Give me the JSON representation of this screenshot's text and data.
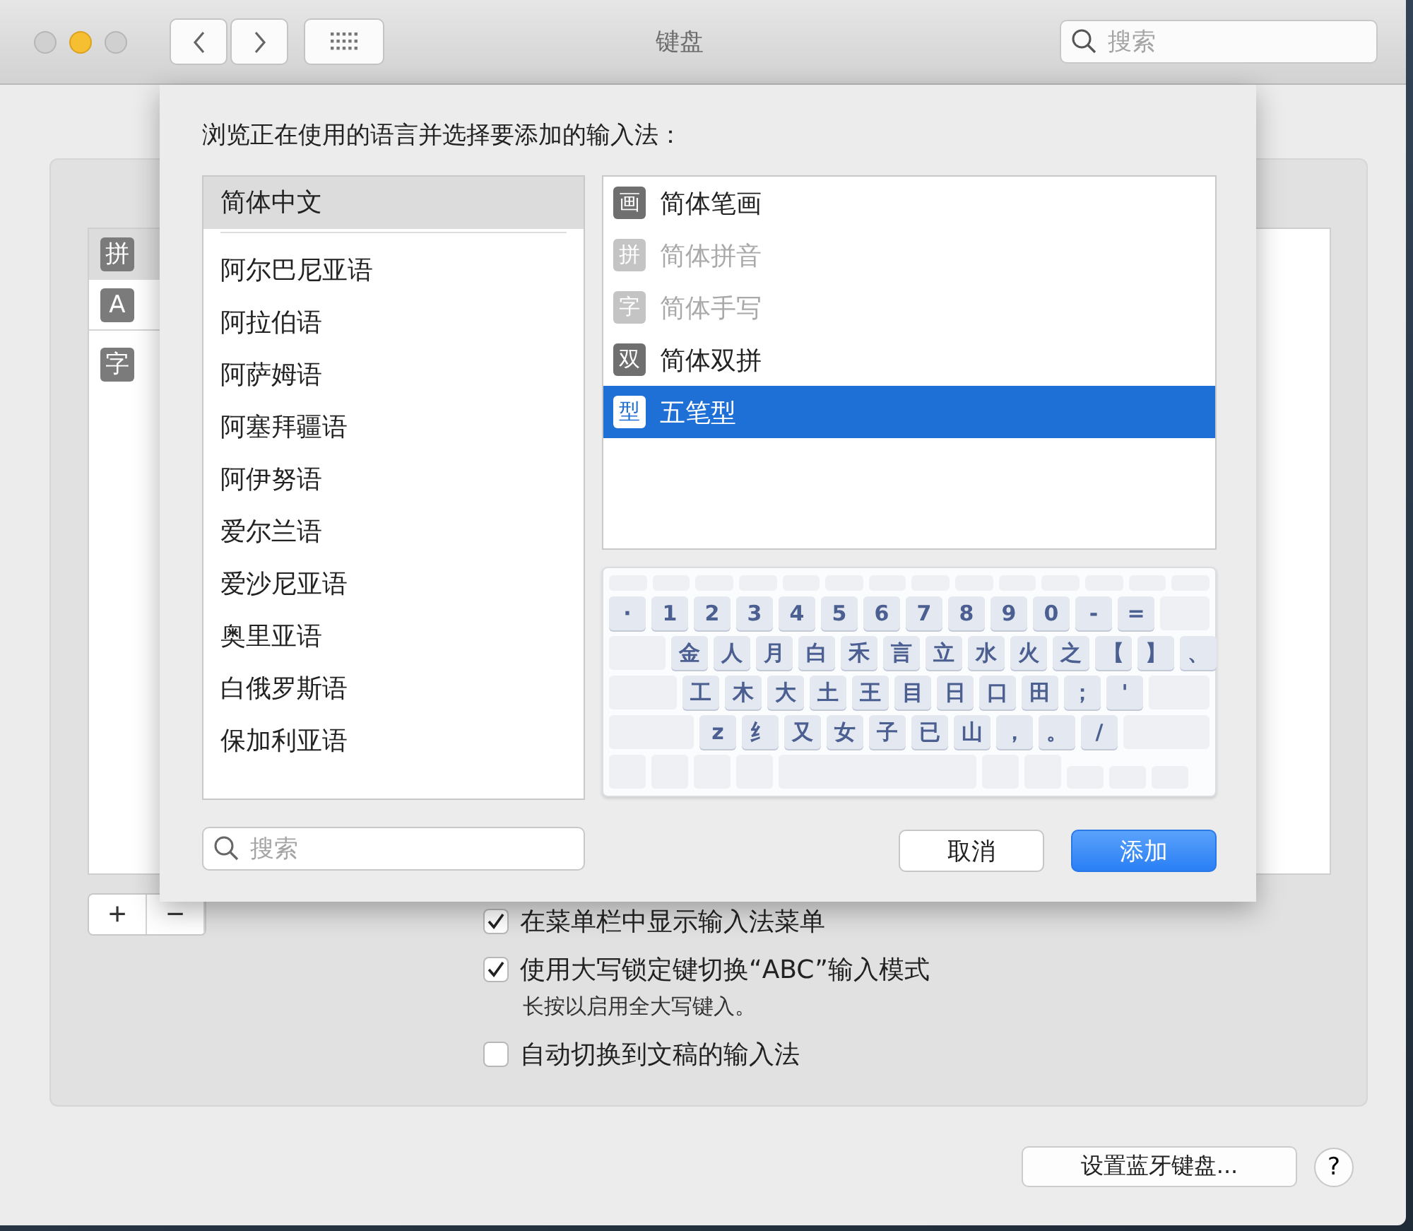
{
  "window": {
    "title": "键盘",
    "search": {
      "placeholder": "搜索"
    }
  },
  "background_list": {
    "items": [
      {
        "icon": "拼",
        "selected": true
      },
      {
        "icon": "A",
        "selected": false
      },
      {
        "icon": "字",
        "selected": false
      }
    ]
  },
  "sheet": {
    "prompt": "浏览正在使用的语言并选择要添加的输入法：",
    "languages": [
      {
        "label": "简体中文",
        "selected": true
      },
      {
        "label": "阿尔巴尼亚语",
        "selected": false
      },
      {
        "label": "阿拉伯语",
        "selected": false
      },
      {
        "label": "阿萨姆语",
        "selected": false
      },
      {
        "label": "阿塞拜疆语",
        "selected": false
      },
      {
        "label": "阿伊努语",
        "selected": false
      },
      {
        "label": "爱尔兰语",
        "selected": false
      },
      {
        "label": "爱沙尼亚语",
        "selected": false
      },
      {
        "label": "奥里亚语",
        "selected": false
      },
      {
        "label": "白俄罗斯语",
        "selected": false
      },
      {
        "label": "保加利亚语",
        "selected": false
      }
    ],
    "input_methods": [
      {
        "icon": "画",
        "label": "简体笔画",
        "disabled": false,
        "selected": false
      },
      {
        "icon": "拼",
        "label": "简体拼音",
        "disabled": true,
        "selected": false
      },
      {
        "icon": "字",
        "label": "简体手写",
        "disabled": true,
        "selected": false
      },
      {
        "icon": "双",
        "label": "简体双拼",
        "disabled": false,
        "selected": false
      },
      {
        "icon": "型",
        "label": "五笔型",
        "disabled": false,
        "selected": true
      }
    ],
    "keyboard": {
      "rows": [
        [
          "·",
          "1",
          "2",
          "3",
          "4",
          "5",
          "6",
          "7",
          "8",
          "9",
          "0",
          "-",
          "="
        ],
        [
          "金",
          "人",
          "月",
          "白",
          "禾",
          "言",
          "立",
          "水",
          "火",
          "之",
          "【",
          "】",
          "、"
        ],
        [
          "工",
          "木",
          "大",
          "土",
          "王",
          "目",
          "日",
          "口",
          "田",
          "；",
          "'"
        ],
        [
          "z",
          "纟",
          "又",
          "女",
          "子",
          "已",
          "山",
          "，",
          "。",
          "/"
        ]
      ]
    },
    "search": {
      "placeholder": "搜索"
    },
    "buttons": [
      {
        "label": "取消",
        "kind": "secondary"
      },
      {
        "label": "添加",
        "kind": "primary"
      }
    ]
  },
  "options": [
    {
      "label": "在菜单栏中显示输入法菜单",
      "checked": true
    },
    {
      "label": "使用大写锁定键切换“ABC”输入模式",
      "checked": true,
      "note": "长按以启用全大写键入。"
    },
    {
      "label": "自动切换到文稿的输入法",
      "checked": false
    }
  ],
  "list_controls": [
    "+",
    "−"
  ],
  "footer": {
    "button": "设置蓝牙键盘...",
    "help": "?"
  }
}
